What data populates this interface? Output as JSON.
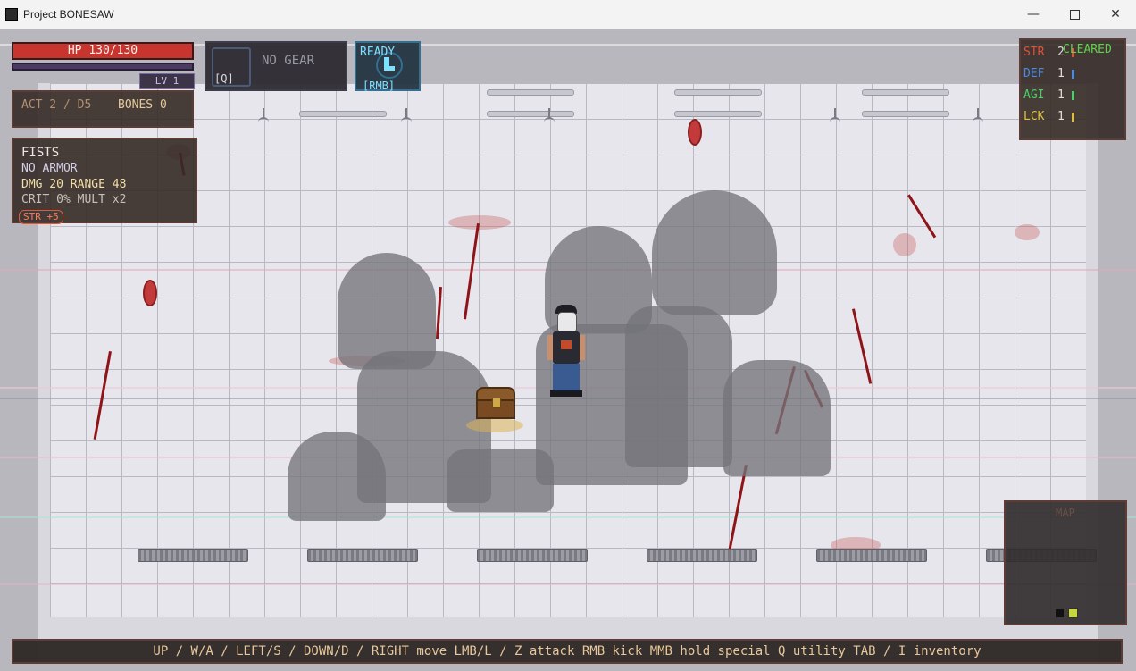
{
  "window": {
    "title": "Project BONESAW",
    "minimize": "—",
    "close": "✕"
  },
  "hud": {
    "hp": "HP 130/130",
    "level": "LV 1",
    "gear": {
      "key": "[Q]",
      "label": "NO GEAR"
    },
    "kick": {
      "status": "READY",
      "key": "[RMB]",
      "icon": "boot-icon"
    },
    "act": "ACT 2 / D5",
    "bones": "BONES 0",
    "weapon": {
      "name": "FISTS",
      "armor": "NO ARMOR",
      "dmg_range": "DMG 20   RANGE 48",
      "crit_mult": "CRIT 0%   MULT x2",
      "bonus": "STR +5"
    },
    "stats": [
      {
        "label": "STR",
        "value": "2",
        "color": "#e0503a"
      },
      {
        "label": "DEF",
        "value": "1",
        "color": "#4a8ae0"
      },
      {
        "label": "AGI",
        "value": "1",
        "color": "#4ad06a"
      },
      {
        "label": "LCK",
        "value": "1",
        "color": "#e0c03a"
      }
    ],
    "cleared": "CLEARED",
    "map_title": "MAP",
    "controls": "UP / W/A / LEFT/S / DOWN/D / RIGHT move   LMB/L / Z attack   RMB kick   MMB hold special   Q utility   TAB / I inventory"
  }
}
